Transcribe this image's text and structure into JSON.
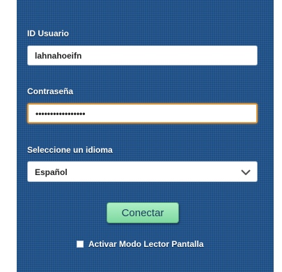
{
  "login": {
    "user_label": "ID Usuario",
    "user_value": "lahnahoeifn",
    "password_label": "Contraseña",
    "password_value": "•••••••••••••••••",
    "language_label": "Seleccione un idioma",
    "language_value": "Español",
    "connect_label": "Conectar",
    "screen_reader_label": "Activar Modo Lector Pantalla"
  },
  "icons": {
    "language_dropdown": "chevron-down-icon"
  },
  "colors": {
    "panel_bg": "#1d4e86",
    "focus_border": "#e39a3a",
    "connect_button": "#8fe0b0"
  }
}
